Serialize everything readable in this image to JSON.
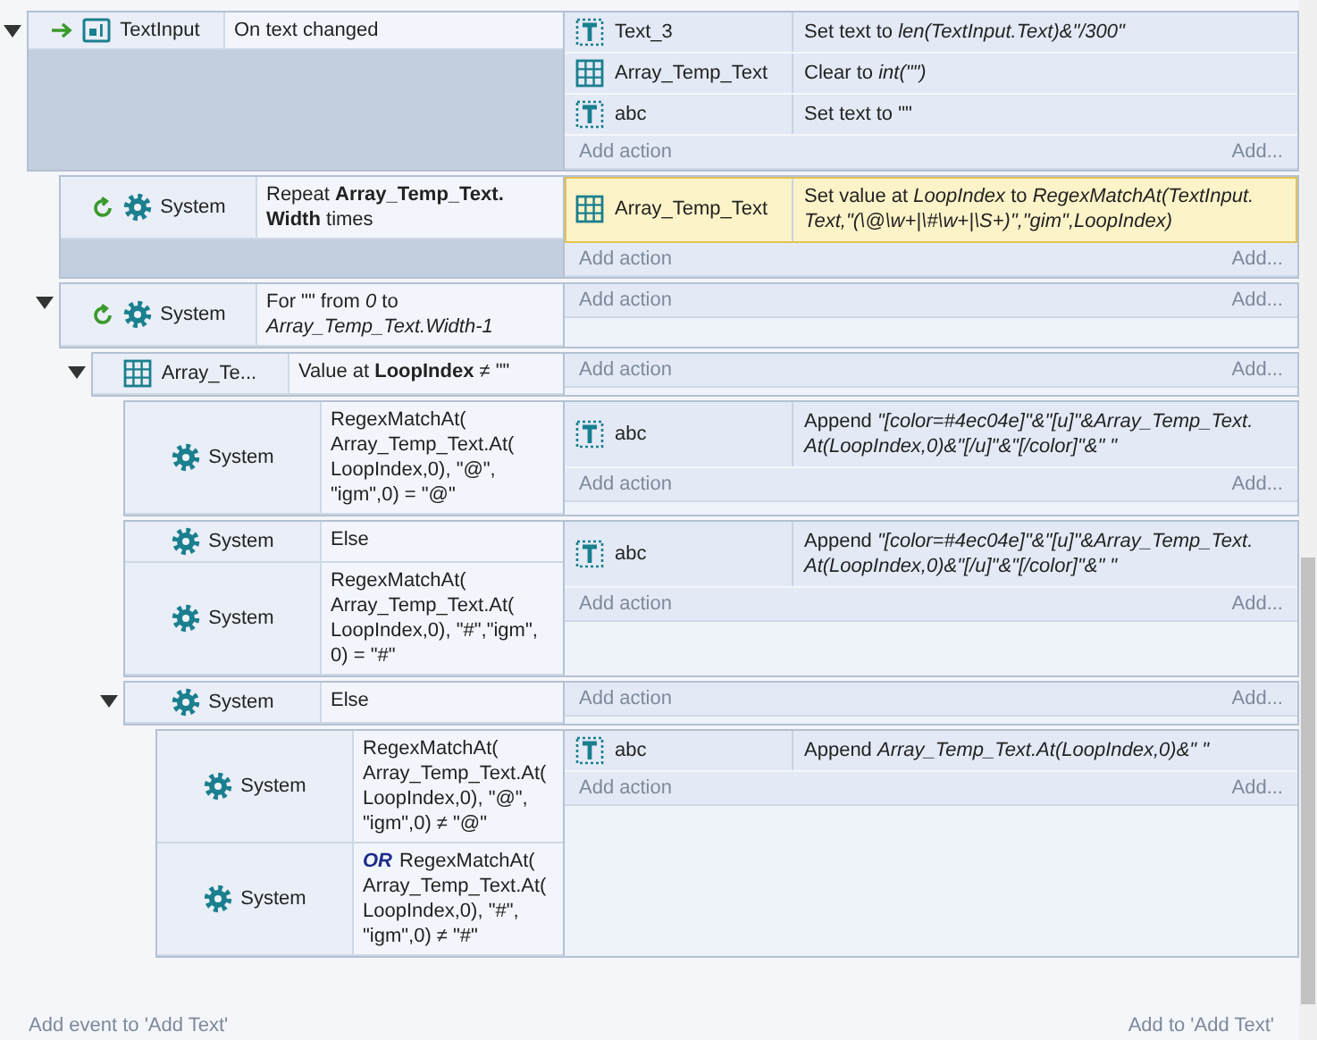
{
  "events": [
    {
      "expanded": true,
      "kind": "trigger",
      "conditions": [
        {
          "object": "TextInput",
          "kind": "text-input",
          "text": "On text changed"
        }
      ],
      "actions": [
        {
          "object": "Text_3",
          "kind": "text",
          "text": "Set text to *len(TextInput.Text)&\"/300\"*",
          "selected": false
        },
        {
          "object": "Array_Temp_Text",
          "kind": "array",
          "text": "Clear to *int(\"\")*",
          "selected": false
        },
        {
          "object": "abc",
          "kind": "text",
          "text": "Set text to \"\"",
          "selected": false
        }
      ],
      "add_action": "Add action",
      "add_more": "Add...",
      "children": [
        {
          "expanded": false,
          "kind": "loop",
          "conditions": [
            {
              "object": "System",
              "kind": "system",
              "text": "Repeat **Array_Temp_Text. Width** times"
            }
          ],
          "actions": [
            {
              "object": "Array_Temp_Text",
              "kind": "array",
              "text": "Set value at *LoopIndex* to *RegexMatchAt(TextInput. Text,\"(\\@\\w+|\\#\\w+|\\S+)\",\"gim\",LoopIndex)*",
              "selected": true
            }
          ],
          "add_action": "Add action",
          "add_more": "Add..."
        },
        {
          "expanded": true,
          "kind": "loop",
          "conditions": [
            {
              "object": "System",
              "kind": "system",
              "text": "For \"\" from *0* to *Array_Temp_Text.Width-1*"
            }
          ],
          "add_action": "Add action",
          "add_more": "Add...",
          "children": [
            {
              "expanded": true,
              "conditions": [
                {
                  "object": "Array_Te...",
                  "kind": "array",
                  "text": "Value at **LoopIndex** ≠ \"\""
                }
              ],
              "add_action": "Add action",
              "add_more": "Add...",
              "children": [
                {
                  "expanded": false,
                  "conditions": [
                    {
                      "object": "System",
                      "kind": "system",
                      "text": "RegexMatchAt( Array_Temp_Text.At( LoopIndex,0), \"@\", \"igm\",0) = \"@\""
                    }
                  ],
                  "actions": [
                    {
                      "object": "abc",
                      "kind": "text",
                      "text": "Append *\"[color=#4ec04e]\"&\"[u]\"&Array_Temp_Text. At(LoopIndex,0)&\"[/u]\"&\"[/color]\"&\" \"*",
                      "selected": false
                    }
                  ],
                  "add_action": "Add action",
                  "add_more": "Add..."
                },
                {
                  "expanded": false,
                  "conditions": [
                    {
                      "object": "System",
                      "kind": "system",
                      "text": "Else"
                    },
                    {
                      "object": "System",
                      "kind": "system",
                      "text": "RegexMatchAt( Array_Temp_Text.At( LoopIndex,0), \"#\",\"igm\", 0) = \"#\""
                    }
                  ],
                  "actions": [
                    {
                      "object": "abc",
                      "kind": "text",
                      "text": "Append *\"[color=#4ec04e]\"&\"[u]\"&Array_Temp_Text. At(LoopIndex,0)&\"[/u]\"&\"[/color]\"&\" \"*",
                      "selected": false
                    }
                  ],
                  "add_action": "Add action",
                  "add_more": "Add..."
                },
                {
                  "expanded": true,
                  "conditions": [
                    {
                      "object": "System",
                      "kind": "system",
                      "text": "Else"
                    }
                  ],
                  "add_action": "Add action",
                  "add_more": "Add...",
                  "children": [
                    {
                      "expanded": false,
                      "conditions": [
                        {
                          "object": "System",
                          "kind": "system",
                          "text": "RegexMatchAt( Array_Temp_Text.At( LoopIndex,0), \"@\", \"igm\",0) ≠ \"@\""
                        },
                        {
                          "object": "System",
                          "kind": "system",
                          "prefix": "OR",
                          "text": "RegexMatchAt( Array_Temp_Text.At( LoopIndex,0), \"#\", \"igm\",0) ≠ \"#\""
                        }
                      ],
                      "actions": [
                        {
                          "object": "abc",
                          "kind": "text",
                          "text": "Append *Array_Temp_Text.At(LoopIndex,0)&\" \"*",
                          "selected": false
                        }
                      ],
                      "add_action": "Add action",
                      "add_more": "Add..."
                    }
                  ]
                }
              ]
            }
          ]
        }
      ]
    }
  ],
  "footer": {
    "add_event": "Add event to 'Add Text'",
    "add_to": "Add to 'Add Text'"
  }
}
